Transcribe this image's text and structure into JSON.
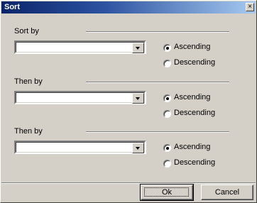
{
  "window": {
    "title": "Sort",
    "close_glyph": "×"
  },
  "sections": [
    {
      "label": "Sort by",
      "value": "",
      "ascending": "Ascending",
      "descending": "Descending",
      "selected": "ascending"
    },
    {
      "label": "Then by",
      "value": "",
      "ascending": "Ascending",
      "descending": "Descending",
      "selected": "ascending"
    },
    {
      "label": "Then by",
      "value": "",
      "ascending": "Ascending",
      "descending": "Descending",
      "selected": "ascending"
    }
  ],
  "buttons": {
    "ok_label": "Ok",
    "cancel_label": "Cancel"
  },
  "colors": {
    "face": "#d4d0c8",
    "title_start": "#0a246a",
    "title_end": "#a6caf0"
  }
}
